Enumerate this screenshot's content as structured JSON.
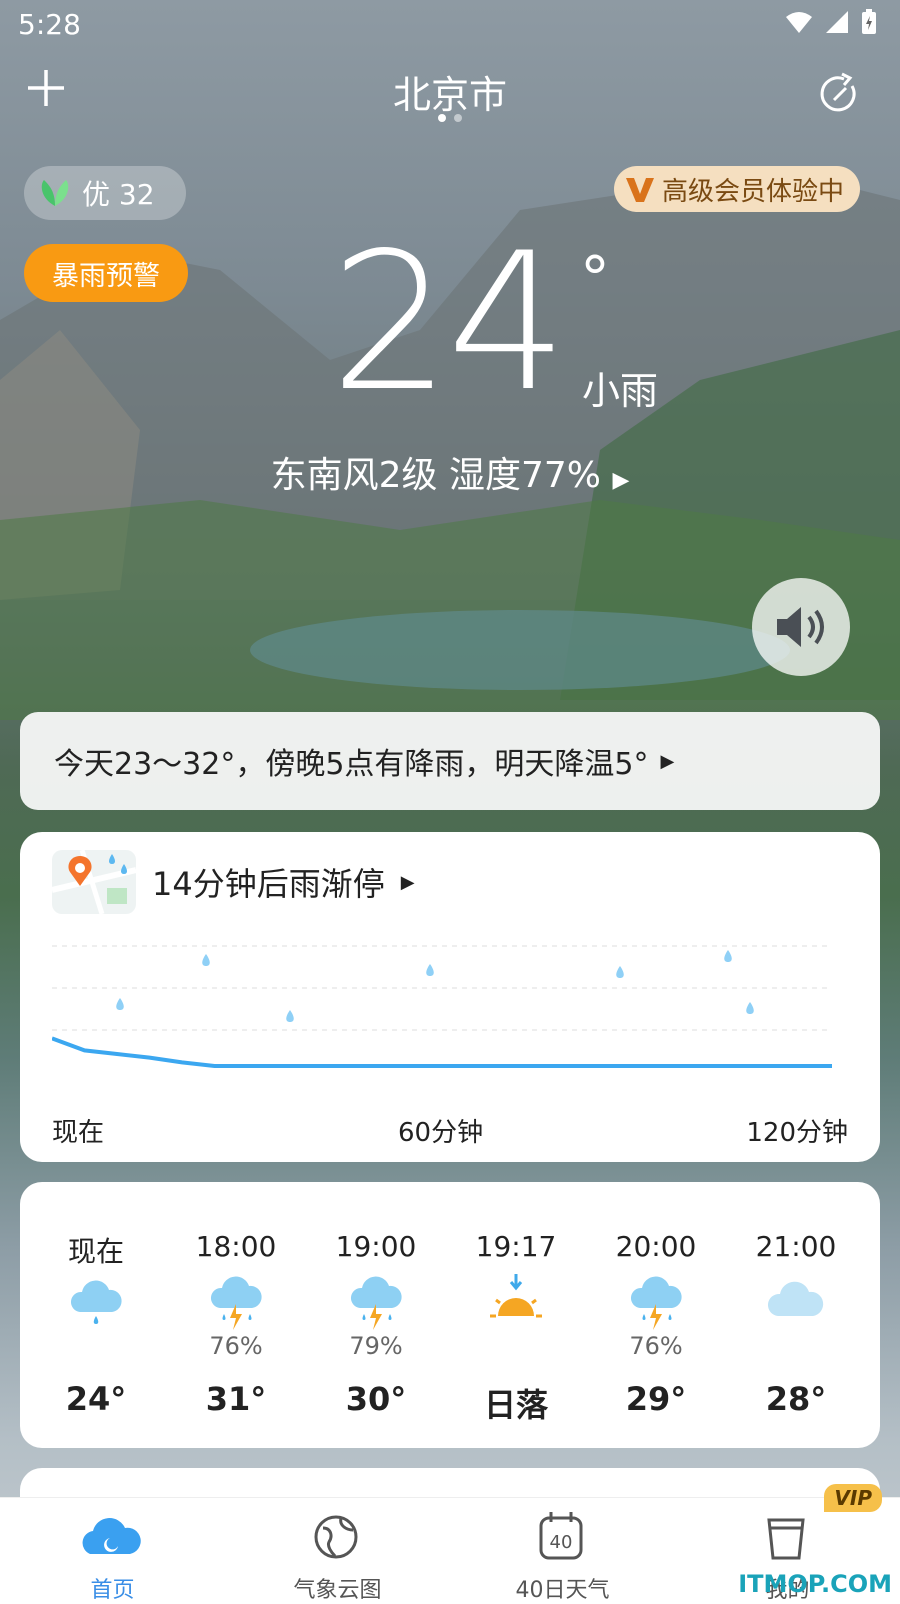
{
  "status": {
    "time": "5:28"
  },
  "header": {
    "city": "北京市",
    "page_dots": 2,
    "active_dot": 1
  },
  "aqi": {
    "label": "优 32"
  },
  "vip_trial": {
    "label": "高级会员体验中",
    "color": "#f5dfc0"
  },
  "warning": {
    "label": "暴雨预警",
    "color": "#f99a12"
  },
  "current": {
    "temp": "24",
    "unit": "°",
    "condition": "小雨",
    "wind_humidity": "东南风2级  湿度77%"
  },
  "summary": {
    "text": "今天23～32°，傍晚5点有降雨，明天降温5°"
  },
  "rain": {
    "title": "14分钟后雨渐停",
    "axis": [
      "现在",
      "60分钟",
      "120分钟"
    ],
    "chart_data": {
      "type": "area",
      "x": [
        0,
        5,
        10,
        15,
        20,
        25,
        120
      ],
      "values": [
        0.28,
        0.18,
        0.15,
        0.12,
        0.08,
        0.05,
        0.05
      ],
      "color": "#3ba7f0"
    }
  },
  "hourly": [
    {
      "time": "现在",
      "icon": "rain-cloud-icon",
      "precip": "",
      "value": "24°"
    },
    {
      "time": "18:00",
      "icon": "thunderstorm-icon",
      "precip": "76%",
      "value": "31°"
    },
    {
      "time": "19:00",
      "icon": "thunderstorm-icon",
      "precip": "79%",
      "value": "30°"
    },
    {
      "time": "19:17",
      "icon": "sunset-icon",
      "precip": "",
      "value": "日落"
    },
    {
      "time": "20:00",
      "icon": "thunderstorm-icon",
      "precip": "76%",
      "value": "29°"
    },
    {
      "time": "21:00",
      "icon": "cloud-icon",
      "precip": "",
      "value": "28°"
    }
  ],
  "nav": [
    {
      "label": "首页",
      "icon": "home-cloud-icon",
      "active": true
    },
    {
      "label": "气象云图",
      "icon": "globe-icon",
      "active": false
    },
    {
      "label": "40日天气",
      "icon": "calendar-40-icon",
      "active": false
    },
    {
      "label": "我的",
      "icon": "profile-cup-icon",
      "active": false
    }
  ],
  "nav_vip_badge": "VIP",
  "watermark": "ITMOP.COM"
}
